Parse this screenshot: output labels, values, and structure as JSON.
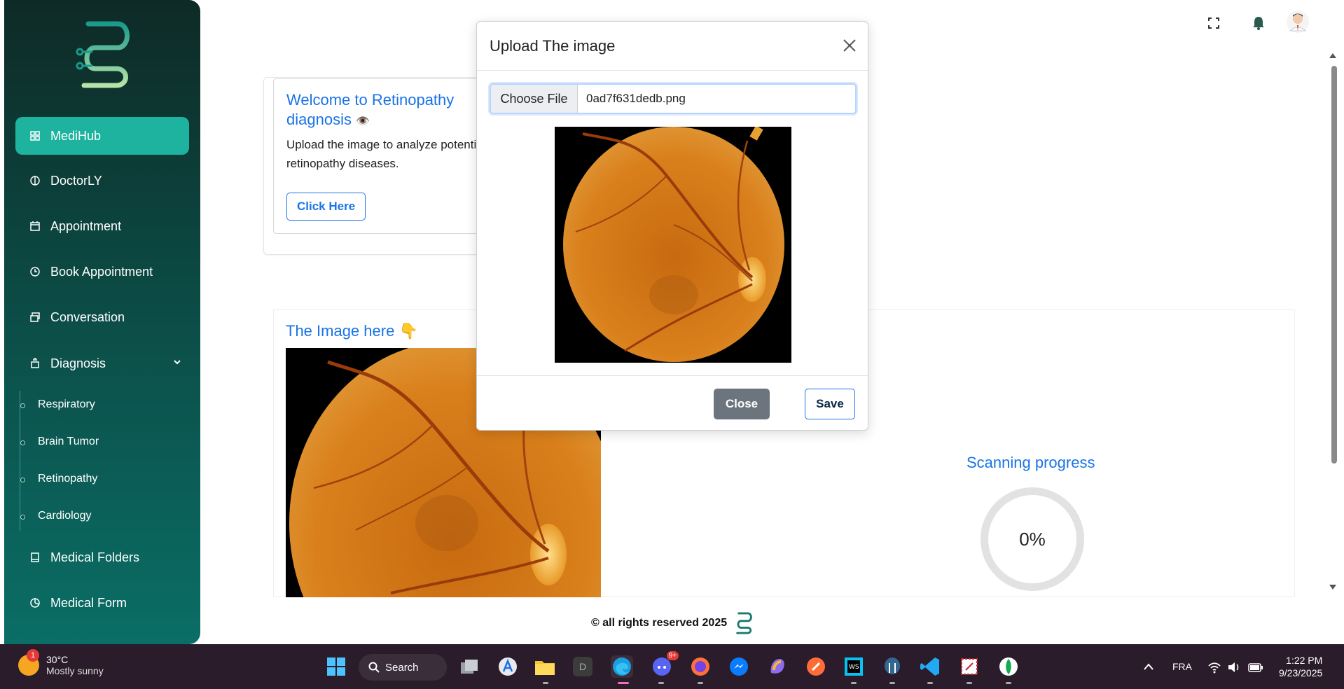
{
  "sidebar": {
    "items": [
      {
        "label": "MediHub",
        "icon": "grid-icon"
      },
      {
        "label": "DoctorLY",
        "icon": "brain-icon"
      },
      {
        "label": "Appointment",
        "icon": "calendar-icon"
      },
      {
        "label": "Book Appointment",
        "icon": "clock-icon"
      },
      {
        "label": "Conversation",
        "icon": "chat-icon"
      },
      {
        "label": "Diagnosis",
        "icon": "stack-icon"
      },
      {
        "label": "Medical Folders",
        "icon": "book-icon"
      },
      {
        "label": "Medical Form",
        "icon": "chart-icon"
      }
    ],
    "diagnosis_sub": [
      "Respiratory",
      "Brain Tumor",
      "Retinopathy",
      "Cardiology"
    ]
  },
  "welcome": {
    "title": "Welcome to Retinopathy diagnosis",
    "emoji": "👁️",
    "text": "Upload the image to analyze potential retinopathy diseases.",
    "button": "Click Here"
  },
  "image_section": {
    "title": "The Image here",
    "emoji": "👇"
  },
  "scan": {
    "title": "Scanning progress",
    "value": "0%"
  },
  "footer": {
    "text": "© all rights reserved 2025"
  },
  "modal": {
    "title": "Upload The image",
    "choose_file": "Choose File",
    "file_name": "0ad7f631dedb.png",
    "close": "Close",
    "save": "Save"
  },
  "taskbar": {
    "weather_temp": "30°C",
    "weather_desc": "Mostly sunny",
    "weather_badge": "1",
    "search": "Search",
    "discord_badge": "9+",
    "lang": "FRA",
    "time": "1:22 PM",
    "date": "9/23/2025"
  },
  "colors": {
    "accent": "#1a73e8",
    "sidebar_active": "#1db39e"
  }
}
